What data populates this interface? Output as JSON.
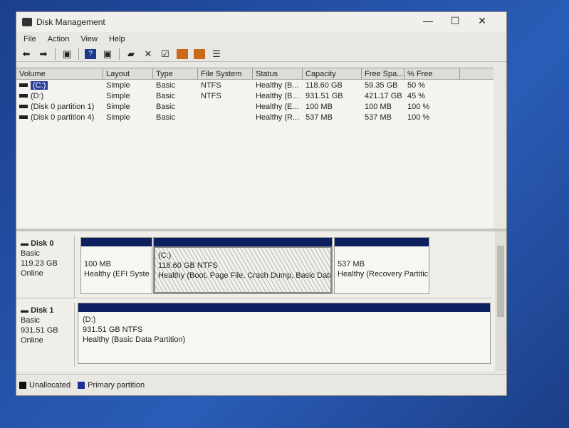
{
  "window": {
    "title": "Disk Management",
    "minimize": "—",
    "maximize": "☐",
    "close": "✕"
  },
  "menu": [
    "File",
    "Action",
    "View",
    "Help"
  ],
  "toolbar_icons": [
    "back-icon",
    "forward-icon",
    "console-icon",
    "help-icon",
    "properties-icon",
    "connect-icon",
    "delete-icon",
    "check-icon",
    "import-icon",
    "rescan-icon",
    "list-icon"
  ],
  "table": {
    "headers": [
      "Volume",
      "Layout",
      "Type",
      "File System",
      "Status",
      "Capacity",
      "Free Spa...",
      "% Free"
    ],
    "rows": [
      [
        "(C:)",
        "Simple",
        "Basic",
        "NTFS",
        "Healthy (B...",
        "118.60 GB",
        "59.35 GB",
        "50 %"
      ],
      [
        "(D:)",
        "Simple",
        "Basic",
        "NTFS",
        "Healthy (B...",
        "931.51 GB",
        "421.17 GB",
        "45 %"
      ],
      [
        "(Disk 0 partition 1)",
        "Simple",
        "Basic",
        "",
        "Healthy (E...",
        "100 MB",
        "100 MB",
        "100 %"
      ],
      [
        "(Disk 0 partition 4)",
        "Simple",
        "Basic",
        "",
        "Healthy (R...",
        "537 MB",
        "537 MB",
        "100 %"
      ]
    ]
  },
  "disks": [
    {
      "name": "Disk 0",
      "type": "Basic",
      "size": "119.23 GB",
      "status": "Online",
      "partitions": [
        {
          "label": "",
          "size": "100 MB",
          "status": "Healthy (EFI Syste"
        },
        {
          "label": "(C:)",
          "size": "118.60 GB NTFS",
          "status": "Healthy (Boot, Page File, Crash Dump, Basic Data"
        },
        {
          "label": "",
          "size": "537 MB",
          "status": "Healthy (Recovery Partitic"
        }
      ]
    },
    {
      "name": "Disk 1",
      "type": "Basic",
      "size": "931.51 GB",
      "status": "Online",
      "partitions": [
        {
          "label": "(D:)",
          "size": "931.51 GB NTFS",
          "status": "Healthy (Basic Data Partition)"
        }
      ]
    }
  ],
  "legend": [
    {
      "label": "Unallocated",
      "color": "#111111"
    },
    {
      "label": "Primary partition",
      "color": "#1a2f9a"
    }
  ],
  "colors": {
    "partition_bar": "#0c1f5e",
    "selection": "#2a3f9a"
  }
}
